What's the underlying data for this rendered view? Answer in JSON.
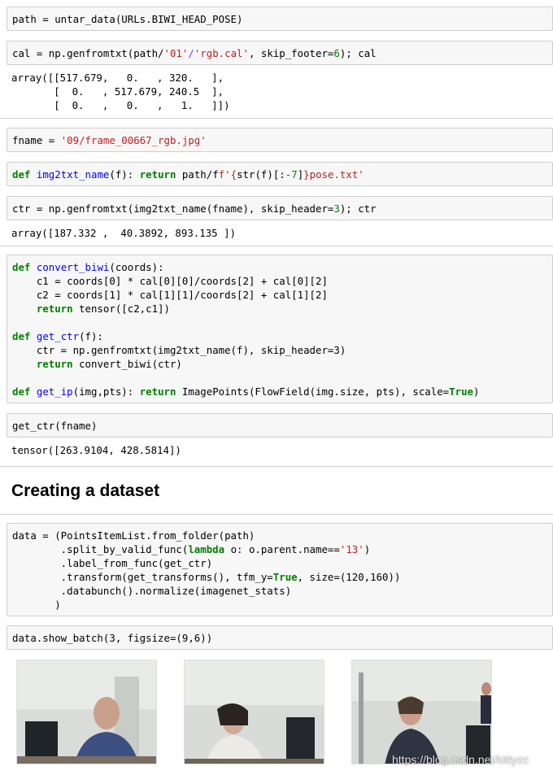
{
  "cells": {
    "c1": {
      "code": "path = untar_data(URLs.BIWI_HEAD_POSE)"
    },
    "c2": {
      "code_a": "cal = np.genfromtxt(path/",
      "code_b": "'01'",
      "code_c": "/",
      "code_d": "'rgb.cal'",
      "code_e": ", skip_footer=",
      "code_f": "6",
      "code_g": "); cal",
      "output": "array([[517.679,   0.   , 320.   ],\n       [  0.   , 517.679, 240.5  ],\n       [  0.   ,   0.   ,   1.   ]])"
    },
    "c3": {
      "code_a": "fname = ",
      "code_b": "'09/frame_00667_rgb.jpg'"
    },
    "c4": {
      "kw1": "def",
      "name": "img2txt_name",
      "sig": "(f): ",
      "kw2": "return",
      "body_a": " path/f",
      "str_a": "f'{",
      "body_b": "str(f)[:",
      "num": "-7",
      "body_c": "]",
      "str_b": "}pose.txt'"
    },
    "c5": {
      "code_a": "ctr = np.genfromtxt(img2txt_name(fname), skip_header=",
      "num": "3",
      "code_b": "); ctr",
      "output": "array([187.332 ,  40.3892, 893.135 ])"
    },
    "c6": {
      "l1_kw": "def",
      "l1_fn": "convert_biwi",
      "l1_rest": "(coords):",
      "l2": "    c1 = coords[0] * cal[0][0]/coords[2] + cal[0][2]",
      "l3": "    c2 = coords[1] * cal[1][1]/coords[2] + cal[1][2]",
      "l4_kw": "    return",
      "l4_rest": " tensor([c2,c1])",
      "l6_kw": "def",
      "l6_fn": "get_ctr",
      "l6_rest": "(f):",
      "l7": "    ctr = np.genfromtxt(img2txt_name(f), skip_header=3)",
      "l8_kw": "    return",
      "l8_rest": " convert_biwi(ctr)",
      "l10_kw": "def",
      "l10_fn": "get_ip",
      "l10_a": "(img,pts): ",
      "l10_kw2": "return",
      "l10_b": " ImagePoints(FlowField(img.size, pts), scale=",
      "l10_true": "True",
      "l10_c": ")"
    },
    "c7": {
      "code": "get_ctr(fname)",
      "output": "tensor([263.9104, 428.5814])"
    },
    "c8": {
      "l1": "data = (PointsItemList.from_folder(path)",
      "l2_a": "        .split_by_valid_func(",
      "l2_kw": "lambda",
      "l2_b": " o: o.parent.name==",
      "l2_str": "'13'",
      "l2_c": ")",
      "l3": "        .label_from_func(get_ctr)",
      "l4_a": "        .transform(get_transforms(), tfm_y=",
      "l4_true": "True",
      "l4_b": ", size=(120,160))",
      "l5": "        .databunch().normalize(imagenet_stats)",
      "l6": "       )"
    },
    "c9": {
      "code": "data.show_batch(3, figsize=(9,6))"
    }
  },
  "heading": "Creating a dataset",
  "watermark": "https://blog.csdn.net/kittyzc"
}
